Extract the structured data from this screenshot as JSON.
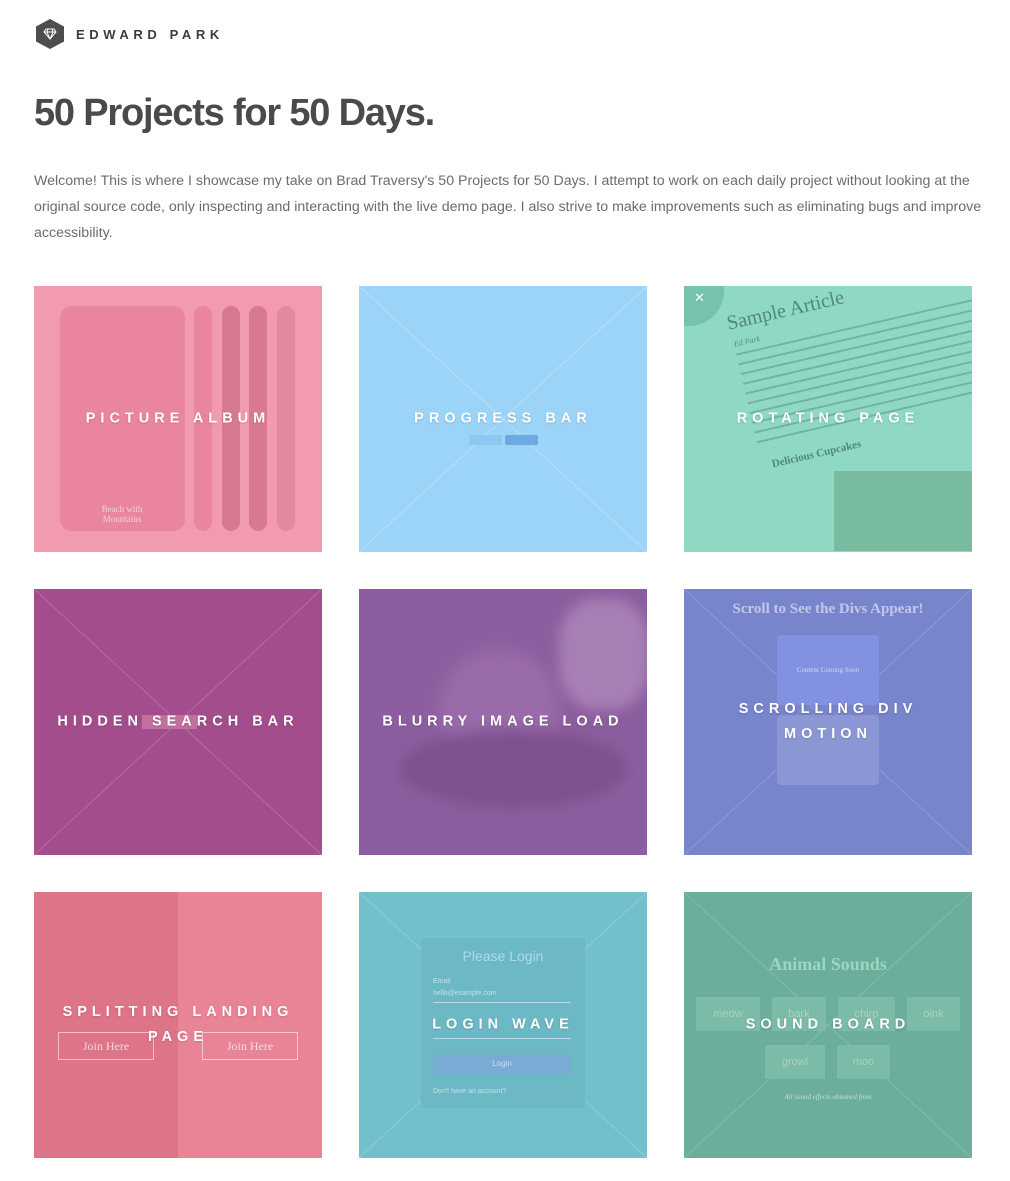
{
  "brand": {
    "name": "EDWARD PARK",
    "icon": "diamond-icon"
  },
  "page_title": "50 Projects for 50 Days.",
  "intro": "Welcome! This is where I showcase my take on Brad Traversy's 50 Projects for 50 Days. I attempt to work on each daily project without looking at the original source code, only inspecting and interacting with the live demo page. I also strive to make improvements such as eliminating bugs and improve accessibility.",
  "projects": [
    {
      "title": "PICTURE ALBUM",
      "color": "#f29bb0",
      "caption": "Beach with Mountains"
    },
    {
      "title": "PROGRESS BAR",
      "color": "#9bd4f7"
    },
    {
      "title": "ROTATING PAGE",
      "color": "#8ed8c4",
      "heading": "Sample Article",
      "subheading": "Ed Park",
      "section": "Delicious Cupcakes"
    },
    {
      "title": "HIDDEN SEARCH BAR",
      "color": "#a34d8d"
    },
    {
      "title": "BLURRY IMAGE LOAD",
      "color": "#8d5e9f"
    },
    {
      "title": "SCROLLING DIV MOTION",
      "color": "#7884cb",
      "heading": "Scroll to See the Divs Appear!",
      "box_text": "Content Coming Soon"
    },
    {
      "title": "SPLITTING LANDING PAGE",
      "color": "#e57e92",
      "button_left": "Join Here",
      "button_right": "Join Here"
    },
    {
      "title": "LOGIN WAVE",
      "color": "#72c0cc",
      "heading": "Please Login",
      "email_label": "Email",
      "email_value": "hello@example.com",
      "button": "Login",
      "footer": "Don't have an account?"
    },
    {
      "title": "SOUND BOARD",
      "color": "#6aae9b",
      "heading": "Animal Sounds",
      "buttons": [
        "meow",
        "bark",
        "chirp",
        "oink",
        "growl",
        "moo"
      ],
      "footer": "All sound effects obtained from"
    }
  ]
}
